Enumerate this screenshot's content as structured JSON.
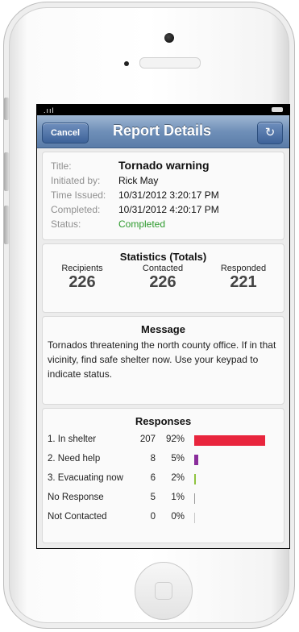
{
  "nav": {
    "cancel_label": "Cancel",
    "title": "Report Details",
    "refresh_icon": "refresh-icon"
  },
  "status_bar": {
    "signal": ".ııl"
  },
  "details": {
    "title_label": "Title:",
    "title_value": "Tornado warning",
    "initiated_label": "Initiated by:",
    "initiated_value": "Rick May",
    "issued_label": "Time Issued:",
    "issued_value": "10/31/2012 3:20:17 PM",
    "completed_label": "Completed:",
    "completed_value": "10/31/2012 4:20:17 PM",
    "status_label": "Status:",
    "status_value": "Completed",
    "status_color": "#2d9a2d"
  },
  "statistics": {
    "heading": "Statistics (Totals)",
    "recipients_label": "Recipients",
    "recipients_value": "226",
    "contacted_label": "Contacted",
    "contacted_value": "226",
    "responded_label": "Responded",
    "responded_value": "221"
  },
  "message": {
    "heading": "Message",
    "text": "Tornados threatening the north county office. If in that vicinity, find safe shelter now. Use your keypad to indicate status."
  },
  "responses": {
    "heading": "Responses",
    "rows": [
      {
        "name": "1. In shelter",
        "count": "207",
        "pct": "92%",
        "fraction": 0.92,
        "color": "#e8253d"
      },
      {
        "name": "2. Need help",
        "count": "8",
        "pct": "5%",
        "fraction": 0.05,
        "color": "#8a2d9b"
      },
      {
        "name": "3. Evacuating now",
        "count": "6",
        "pct": "2%",
        "fraction": 0.02,
        "color": "#8fc43f"
      },
      {
        "name": "No Response",
        "count": "5",
        "pct": "1%",
        "fraction": 0.01,
        "color": "#9a9a9a"
      },
      {
        "name": "Not Contacted",
        "count": "0",
        "pct": "0%",
        "fraction": 0.0,
        "color": "#c8c8c8"
      }
    ]
  }
}
